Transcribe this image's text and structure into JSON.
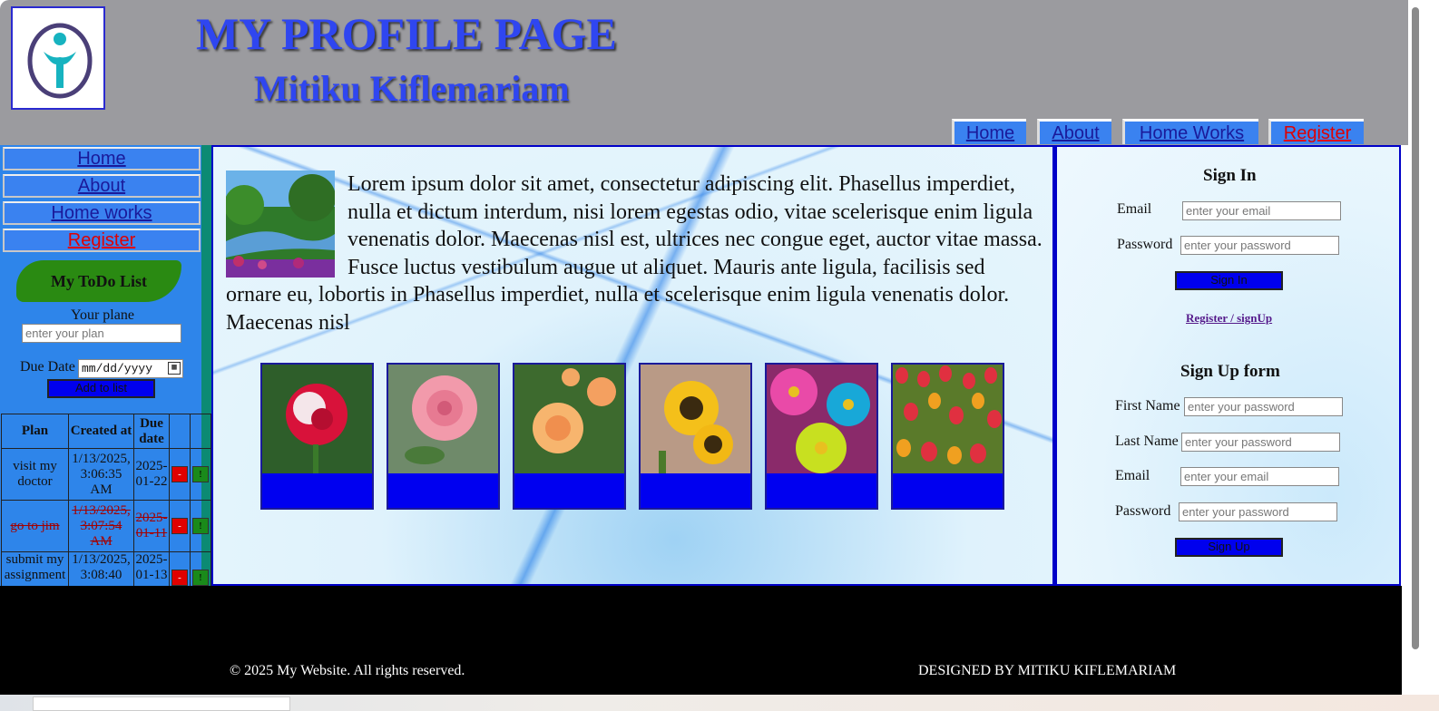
{
  "header": {
    "title": "MY PROFILE PAGE",
    "subtitle": "Mitiku Kiflemariam",
    "logo_icon": "person-logo-icon",
    "nav": [
      {
        "label": "Home"
      },
      {
        "label": "About"
      },
      {
        "label": "Home Works"
      },
      {
        "label": "Register"
      }
    ]
  },
  "sidebar": {
    "nav": [
      {
        "label": "Home"
      },
      {
        "label": "About"
      },
      {
        "label": "Home works"
      },
      {
        "label": "Register"
      }
    ],
    "todo": {
      "title": "My ToDo List",
      "plan_label": "Your plane",
      "plan_placeholder": "enter your plan",
      "due_label": "Due Date",
      "due_placeholder": "mm/dd/yyyy",
      "add_button": "Add to list",
      "columns": [
        "Plan",
        "Created at",
        "Due date"
      ],
      "rows": [
        {
          "plan": "visit my doctor",
          "created": "1/13/2025, 3:06:35 AM",
          "due": "2025-01-22",
          "done": false
        },
        {
          "plan": "go to jim",
          "created": "1/13/2025, 3:07:54 AM",
          "due": "2025-01-11",
          "done": true
        },
        {
          "plan": "submit my assignment",
          "created": "1/13/2025, 3:08:40",
          "due": "2025-01-13",
          "done": false
        }
      ],
      "delete_symbol": "-",
      "done_symbol": "!"
    }
  },
  "main": {
    "paragraph": "Lorem ipsum dolor sit amet, consectetur adipiscing elit. Phasellus imperdiet, nulla et dictum interdum, nisi lorem egestas odio, vitae scelerisque enim ligula venenatis dolor. Maecenas nisl est, ultrices nec congue eget, auctor vitae massa. Fusce luctus vestibulum augue ut aliquet. Mauris ante ligula, facilisis sed ornare eu, lobortis in Phasellus imperdiet, nulla et scelerisque enim ligula venenatis dolor. Maecenas nisl",
    "gallery": [
      "red-rose",
      "pink-rose",
      "peach-rose",
      "sunflower",
      "daisies",
      "tulips"
    ]
  },
  "signin": {
    "title": "Sign In",
    "email_label": "Email",
    "email_placeholder": "enter your email",
    "password_label": "Password",
    "password_placeholder": "enter your password",
    "button": "Sign In",
    "register_link": "Register / signUp"
  },
  "signup": {
    "title": "Sign Up form",
    "first_label": "First Name",
    "first_placeholder": "enter your password",
    "last_label": "Last Name",
    "last_placeholder": "enter your password",
    "email_label": "Email",
    "email_placeholder": "enter your email",
    "password_label": "Password",
    "password_placeholder": "enter your password",
    "button": "Sign Up"
  },
  "footer": {
    "copyright": "© 2025 My Website. All rights reserved.",
    "designer": "DESIGNED BY MITIKU KIFLEMARIAM"
  },
  "colors": {
    "header_bg": "#9b9b9f",
    "accent_blue": "#2f46f0",
    "nav_bg": "#3a82f0",
    "button_blue": "#0000ee",
    "register_red": "#e00000"
  }
}
